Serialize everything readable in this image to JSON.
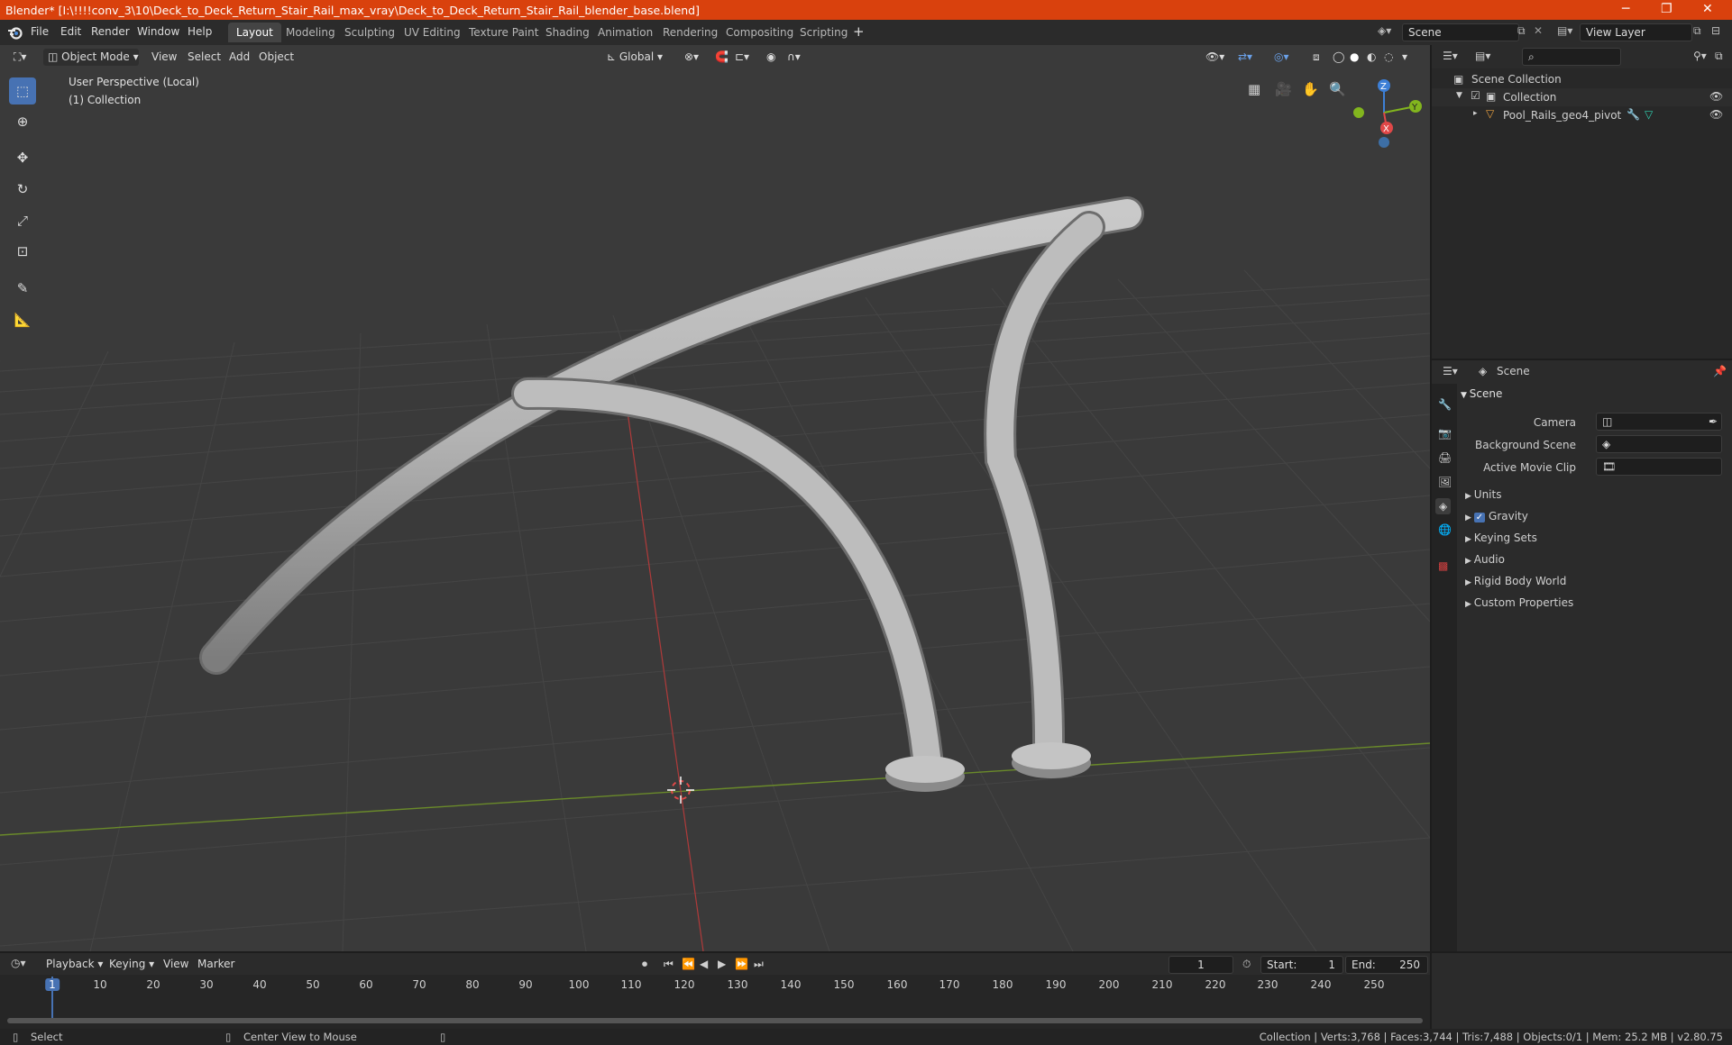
{
  "window": {
    "title": "Blender* [I:\\!!!!conv_3\\10\\Deck_to_Deck_Return_Stair_Rail_max_vray\\Deck_to_Deck_Return_Stair_Rail_blender_base.blend]",
    "minimize": "─",
    "maximize": "❐",
    "close": "✕"
  },
  "menu": {
    "file": "File",
    "edit": "Edit",
    "render": "Render",
    "window": "Window",
    "help": "Help"
  },
  "workspaces": [
    "Layout",
    "Modeling",
    "Sculpting",
    "UV Editing",
    "Texture Paint",
    "Shading",
    "Animation",
    "Rendering",
    "Compositing",
    "Scripting"
  ],
  "active_workspace": "Layout",
  "scene_field": "Scene",
  "view_layer_field": "View Layer",
  "viewport": {
    "mode": "Object Mode",
    "view": "View",
    "select": "Select",
    "add": "Add",
    "object": "Object",
    "transform_orientation": "Global",
    "overlay_line1": "User Perspective (Local)",
    "overlay_line2": "(1) Collection",
    "gizmo": {
      "z": "Z",
      "y": "Y",
      "x": "X"
    }
  },
  "outliner": {
    "root": "Scene Collection",
    "collection": "Collection",
    "object": "Pool_Rails_geo4_pivot"
  },
  "properties": {
    "header": "Scene",
    "panel": "Scene",
    "camera_label": "Camera",
    "background_scene_label": "Background Scene",
    "active_movie_clip_label": "Active Movie Clip",
    "sections": [
      "Units",
      "Gravity",
      "Keying Sets",
      "Audio",
      "Rigid Body World",
      "Custom Properties"
    ],
    "gravity_checked": true
  },
  "timeline": {
    "playback": "Playback",
    "keying": "Keying",
    "view": "View",
    "marker": "Marker",
    "current_frame": "1",
    "start_label": "Start:",
    "start": "1",
    "end_label": "End:",
    "end": "250",
    "ticks": [
      "1",
      "10",
      "20",
      "30",
      "40",
      "50",
      "60",
      "70",
      "80",
      "90",
      "100",
      "110",
      "120",
      "130",
      "140",
      "150",
      "160",
      "170",
      "180",
      "190",
      "200",
      "210",
      "220",
      "230",
      "240",
      "250"
    ]
  },
  "statusbar": {
    "select": "Select",
    "center_view": "Center View to Mouse",
    "stats": "Collection | Verts:3,768 | Faces:3,744 | Tris:7,488 | Objects:0/1 | Mem: 25.2 MB | v2.80.75"
  },
  "colors": {
    "accent": "#4772b3",
    "titlebar": "#d9410d",
    "x_axis": "#e04848",
    "y_axis": "#82b51e",
    "z_axis": "#3d7fd6"
  }
}
